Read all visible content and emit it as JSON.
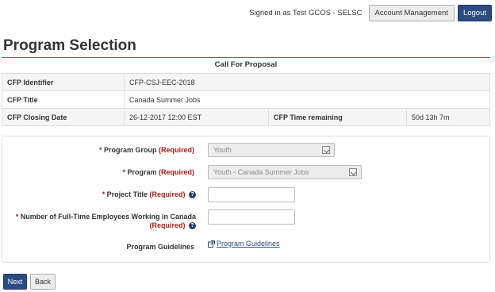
{
  "header": {
    "signed_in_text": "Signed in as Test GCOS - SELSC",
    "account_button": "Account Management",
    "logout_button": "Logout"
  },
  "page": {
    "title": "Program Selection"
  },
  "cfp": {
    "heading": "Call For Proposal",
    "identifier_label": "CFP Identifier",
    "identifier_value": "CFP-CSJ-EEC-2018",
    "title_label": "CFP Title",
    "title_value": "Canada Summer Jobs",
    "closing_label": "CFP Closing Date",
    "closing_value": "26-12-2017 12:00 EST",
    "remaining_label": "CFP Time remaining",
    "remaining_value": "50d 13h 7m"
  },
  "form": {
    "required_star": "*",
    "required_text": "(Required)",
    "program_group_label": "Program Group",
    "program_group_value": "Youth",
    "program_label": "Program",
    "program_value": "Youth - Canada Summer Jobs",
    "project_title_label": "Project Title",
    "project_title_value": "",
    "employees_label": "Number of Full-Time Employees Working in Canada",
    "employees_value": "",
    "guidelines_label": "Program Guidelines",
    "guidelines_link": "Program Guidelines",
    "help_glyph": "?"
  },
  "footer": {
    "next_button": "Next",
    "back_button": "Back"
  },
  "colors": {
    "primary": "#2b4c80",
    "required": "#b01c1c",
    "title_rule": "#b84a4a"
  }
}
